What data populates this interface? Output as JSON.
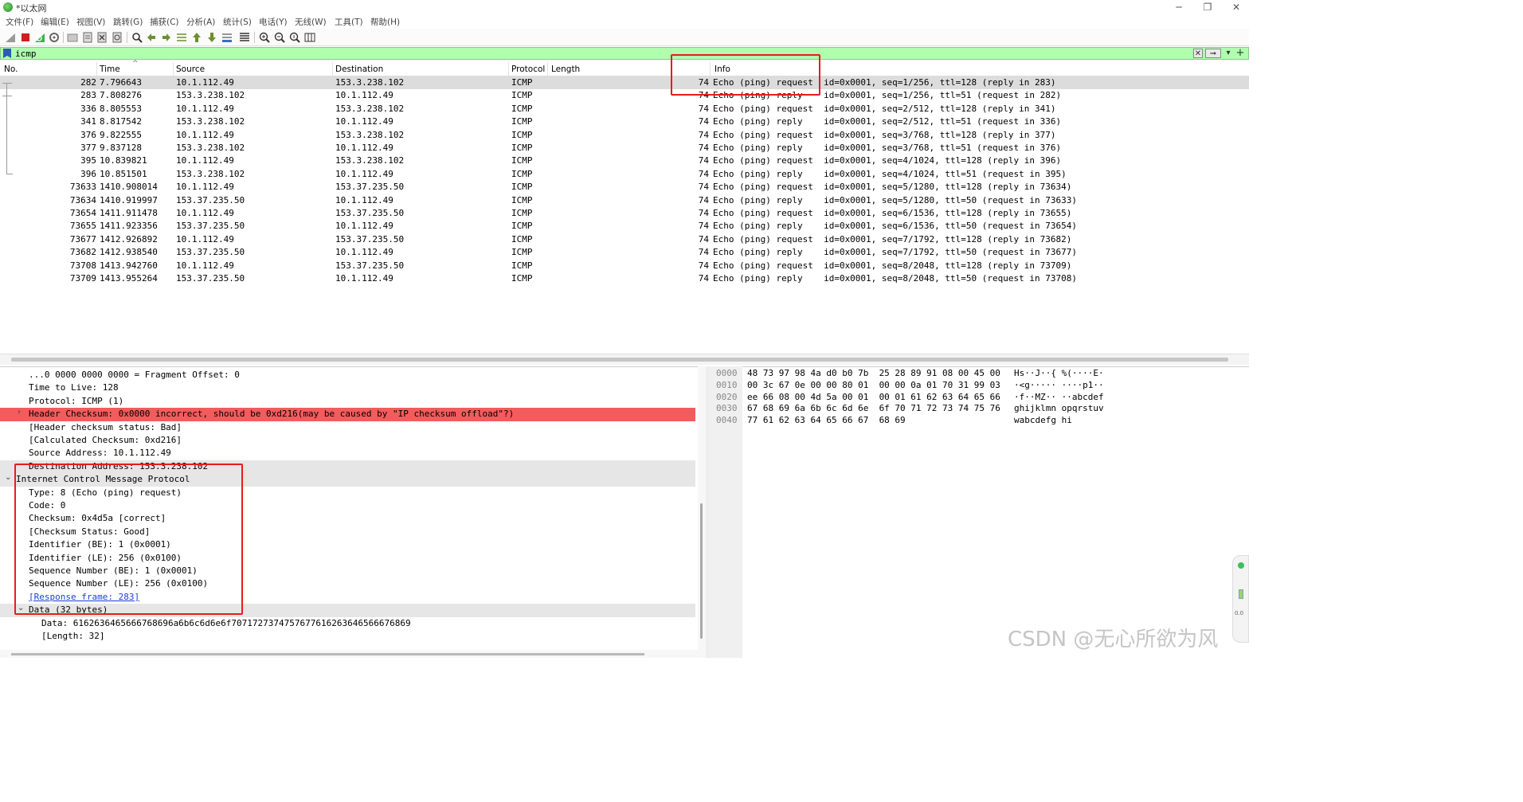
{
  "window": {
    "title": "*以太网",
    "controls": [
      "minimize",
      "maximize",
      "close"
    ]
  },
  "menu": [
    "文件(F)",
    "编辑(E)",
    "视图(V)",
    "跳转(G)",
    "捕获(C)",
    "分析(A)",
    "统计(S)",
    "电话(Y)",
    "无线(W)",
    "工具(T)",
    "帮助(H)"
  ],
  "toolbar": {
    "icons": [
      "shark-fin-start-icon",
      "stop-capture-icon",
      "restart-capture-icon",
      "capture-options-icon",
      "open-file-icon",
      "save-file-icon",
      "close-file-icon",
      "reload-file-icon",
      "find-packet-icon",
      "go-back-icon",
      "go-forward-icon",
      "go-to-packet-icon",
      "go-first-icon",
      "go-last-icon",
      "auto-scroll-icon",
      "colorize-icon",
      "zoom-in-icon",
      "zoom-out-icon",
      "zoom-normal-icon",
      "resize-columns-icon"
    ]
  },
  "filter": {
    "value": "icmp",
    "clear_label": "✕",
    "apply_label": "➞",
    "dropdown_label": "▾",
    "add_label": "+"
  },
  "packet_list": {
    "columns": [
      "No.",
      "Time",
      "Source",
      "Destination",
      "Protocol",
      "Length",
      "Info"
    ],
    "rows": [
      {
        "no": "282",
        "time": "7.796643",
        "src": "10.1.112.49",
        "dst": "153.3.238.102",
        "proto": "ICMP",
        "len": "74",
        "info": "Echo (ping) request  id=0x0001, seq=1/256, ttl=128 (reply in 283)"
      },
      {
        "no": "283",
        "time": "7.808276",
        "src": "153.3.238.102",
        "dst": "10.1.112.49",
        "proto": "ICMP",
        "len": "74",
        "info": "Echo (ping) reply    id=0x0001, seq=1/256, ttl=51 (request in 282)"
      },
      {
        "no": "336",
        "time": "8.805553",
        "src": "10.1.112.49",
        "dst": "153.3.238.102",
        "proto": "ICMP",
        "len": "74",
        "info": "Echo (ping) request  id=0x0001, seq=2/512, ttl=128 (reply in 341)"
      },
      {
        "no": "341",
        "time": "8.817542",
        "src": "153.3.238.102",
        "dst": "10.1.112.49",
        "proto": "ICMP",
        "len": "74",
        "info": "Echo (ping) reply    id=0x0001, seq=2/512, ttl=51 (request in 336)"
      },
      {
        "no": "376",
        "time": "9.822555",
        "src": "10.1.112.49",
        "dst": "153.3.238.102",
        "proto": "ICMP",
        "len": "74",
        "info": "Echo (ping) request  id=0x0001, seq=3/768, ttl=128 (reply in 377)"
      },
      {
        "no": "377",
        "time": "9.837128",
        "src": "153.3.238.102",
        "dst": "10.1.112.49",
        "proto": "ICMP",
        "len": "74",
        "info": "Echo (ping) reply    id=0x0001, seq=3/768, ttl=51 (request in 376)"
      },
      {
        "no": "395",
        "time": "10.839821",
        "src": "10.1.112.49",
        "dst": "153.3.238.102",
        "proto": "ICMP",
        "len": "74",
        "info": "Echo (ping) request  id=0x0001, seq=4/1024, ttl=128 (reply in 396)"
      },
      {
        "no": "396",
        "time": "10.851501",
        "src": "153.3.238.102",
        "dst": "10.1.112.49",
        "proto": "ICMP",
        "len": "74",
        "info": "Echo (ping) reply    id=0x0001, seq=4/1024, ttl=51 (request in 395)"
      },
      {
        "no": "73633",
        "time": "1410.908014",
        "src": "10.1.112.49",
        "dst": "153.37.235.50",
        "proto": "ICMP",
        "len": "74",
        "info": "Echo (ping) request  id=0x0001, seq=5/1280, ttl=128 (reply in 73634)"
      },
      {
        "no": "73634",
        "time": "1410.919997",
        "src": "153.37.235.50",
        "dst": "10.1.112.49",
        "proto": "ICMP",
        "len": "74",
        "info": "Echo (ping) reply    id=0x0001, seq=5/1280, ttl=50 (request in 73633)"
      },
      {
        "no": "73654",
        "time": "1411.911478",
        "src": "10.1.112.49",
        "dst": "153.37.235.50",
        "proto": "ICMP",
        "len": "74",
        "info": "Echo (ping) request  id=0x0001, seq=6/1536, ttl=128 (reply in 73655)"
      },
      {
        "no": "73655",
        "time": "1411.923356",
        "src": "153.37.235.50",
        "dst": "10.1.112.49",
        "proto": "ICMP",
        "len": "74",
        "info": "Echo (ping) reply    id=0x0001, seq=6/1536, ttl=50 (request in 73654)"
      },
      {
        "no": "73677",
        "time": "1412.926892",
        "src": "10.1.112.49",
        "dst": "153.37.235.50",
        "proto": "ICMP",
        "len": "74",
        "info": "Echo (ping) request  id=0x0001, seq=7/1792, ttl=128 (reply in 73682)"
      },
      {
        "no": "73682",
        "time": "1412.938540",
        "src": "153.37.235.50",
        "dst": "10.1.112.49",
        "proto": "ICMP",
        "len": "74",
        "info": "Echo (ping) reply    id=0x0001, seq=7/1792, ttl=50 (request in 73677)"
      },
      {
        "no": "73708",
        "time": "1413.942760",
        "src": "10.1.112.49",
        "dst": "153.37.235.50",
        "proto": "ICMP",
        "len": "74",
        "info": "Echo (ping) request  id=0x0001, seq=8/2048, ttl=128 (reply in 73709)"
      },
      {
        "no": "73709",
        "time": "1413.955264",
        "src": "153.37.235.50",
        "dst": "10.1.112.49",
        "proto": "ICMP",
        "len": "74",
        "info": "Echo (ping) reply    id=0x0001, seq=8/2048, ttl=50 (request in 73708)"
      }
    ],
    "selected_row": 0
  },
  "details": [
    {
      "text": "...0 0000 0000 0000 = Fragment Offset: 0",
      "style": "normal",
      "arrow": ""
    },
    {
      "text": "Time to Live: 128",
      "style": "normal",
      "arrow": ""
    },
    {
      "text": "Protocol: ICMP (1)",
      "style": "normal",
      "arrow": ""
    },
    {
      "text": "Header Checksum: 0x0000 incorrect, should be 0xd216(may be caused by \"IP checksum offload\"?)",
      "style": "err",
      "arrow": "›"
    },
    {
      "text": "[Header checksum status: Bad]",
      "style": "normal",
      "arrow": ""
    },
    {
      "text": "[Calculated Checksum: 0xd216]",
      "style": "normal",
      "arrow": ""
    },
    {
      "text": "Source Address: 10.1.112.49",
      "style": "normal",
      "arrow": ""
    },
    {
      "text": "Destination Address: 153.3.238.102",
      "style": "grey",
      "arrow": ""
    },
    {
      "text": "Internet Control Message Protocol",
      "style": "grey",
      "arrow": "⌄"
    },
    {
      "text": "Type: 8 (Echo (ping) request)",
      "style": "normal",
      "arrow": ""
    },
    {
      "text": "Code: 0",
      "style": "normal",
      "arrow": ""
    },
    {
      "text": "Checksum: 0x4d5a [correct]",
      "style": "normal",
      "arrow": ""
    },
    {
      "text": "[Checksum Status: Good]",
      "style": "normal",
      "arrow": ""
    },
    {
      "text": "Identifier (BE): 1 (0x0001)",
      "style": "normal",
      "arrow": ""
    },
    {
      "text": "Identifier (LE): 256 (0x0100)",
      "style": "normal",
      "arrow": ""
    },
    {
      "text": "Sequence Number (BE): 1 (0x0001)",
      "style": "normal",
      "arrow": ""
    },
    {
      "text": "Sequence Number (LE): 256 (0x0100)",
      "style": "normal",
      "arrow": ""
    },
    {
      "text": "[Response frame: 283]",
      "style": "link",
      "arrow": ""
    },
    {
      "text": "Data (32 bytes)",
      "style": "grey",
      "arrow": "⌄"
    },
    {
      "text": "Data: 6162636465666768696a6b6c6d6e6f7071727374757677616263646566676869",
      "style": "normal",
      "arrow": ""
    },
    {
      "text": "[Length: 32]",
      "style": "normal",
      "arrow": ""
    }
  ],
  "hex_dump": [
    {
      "offset": "0000",
      "bytes": "48 73 97 98 4a d0 b0 7b  25 28 89 91 08 00 45 00",
      "ascii": "Hs··J··{ %(····E·"
    },
    {
      "offset": "0010",
      "bytes": "00 3c 67 0e 00 00 80 01  00 00 0a 01 70 31 99 03",
      "ascii": "·<g····· ····p1··"
    },
    {
      "offset": "0020",
      "bytes": "ee 66 08 00 4d 5a 00 01  00 01 61 62 63 64 65 66",
      "ascii": "·f··MZ·· ··abcdef"
    },
    {
      "offset": "0030",
      "bytes": "67 68 69 6a 6b 6c 6d 6e  6f 70 71 72 73 74 75 76",
      "ascii": "ghijklmn opqrstuv"
    },
    {
      "offset": "0040",
      "bytes": "77 61 62 63 64 65 66 67  68 69",
      "ascii": "wabcdefg hi"
    }
  ],
  "watermark": "CSDN @无心所欲为风",
  "side_widget": {
    "value": "0.0"
  },
  "colors": {
    "filter_bg": "#afffaf",
    "error_row": "#f25c5c",
    "selected_row": "#dcdcdc",
    "annotation": "#e41d1d"
  }
}
